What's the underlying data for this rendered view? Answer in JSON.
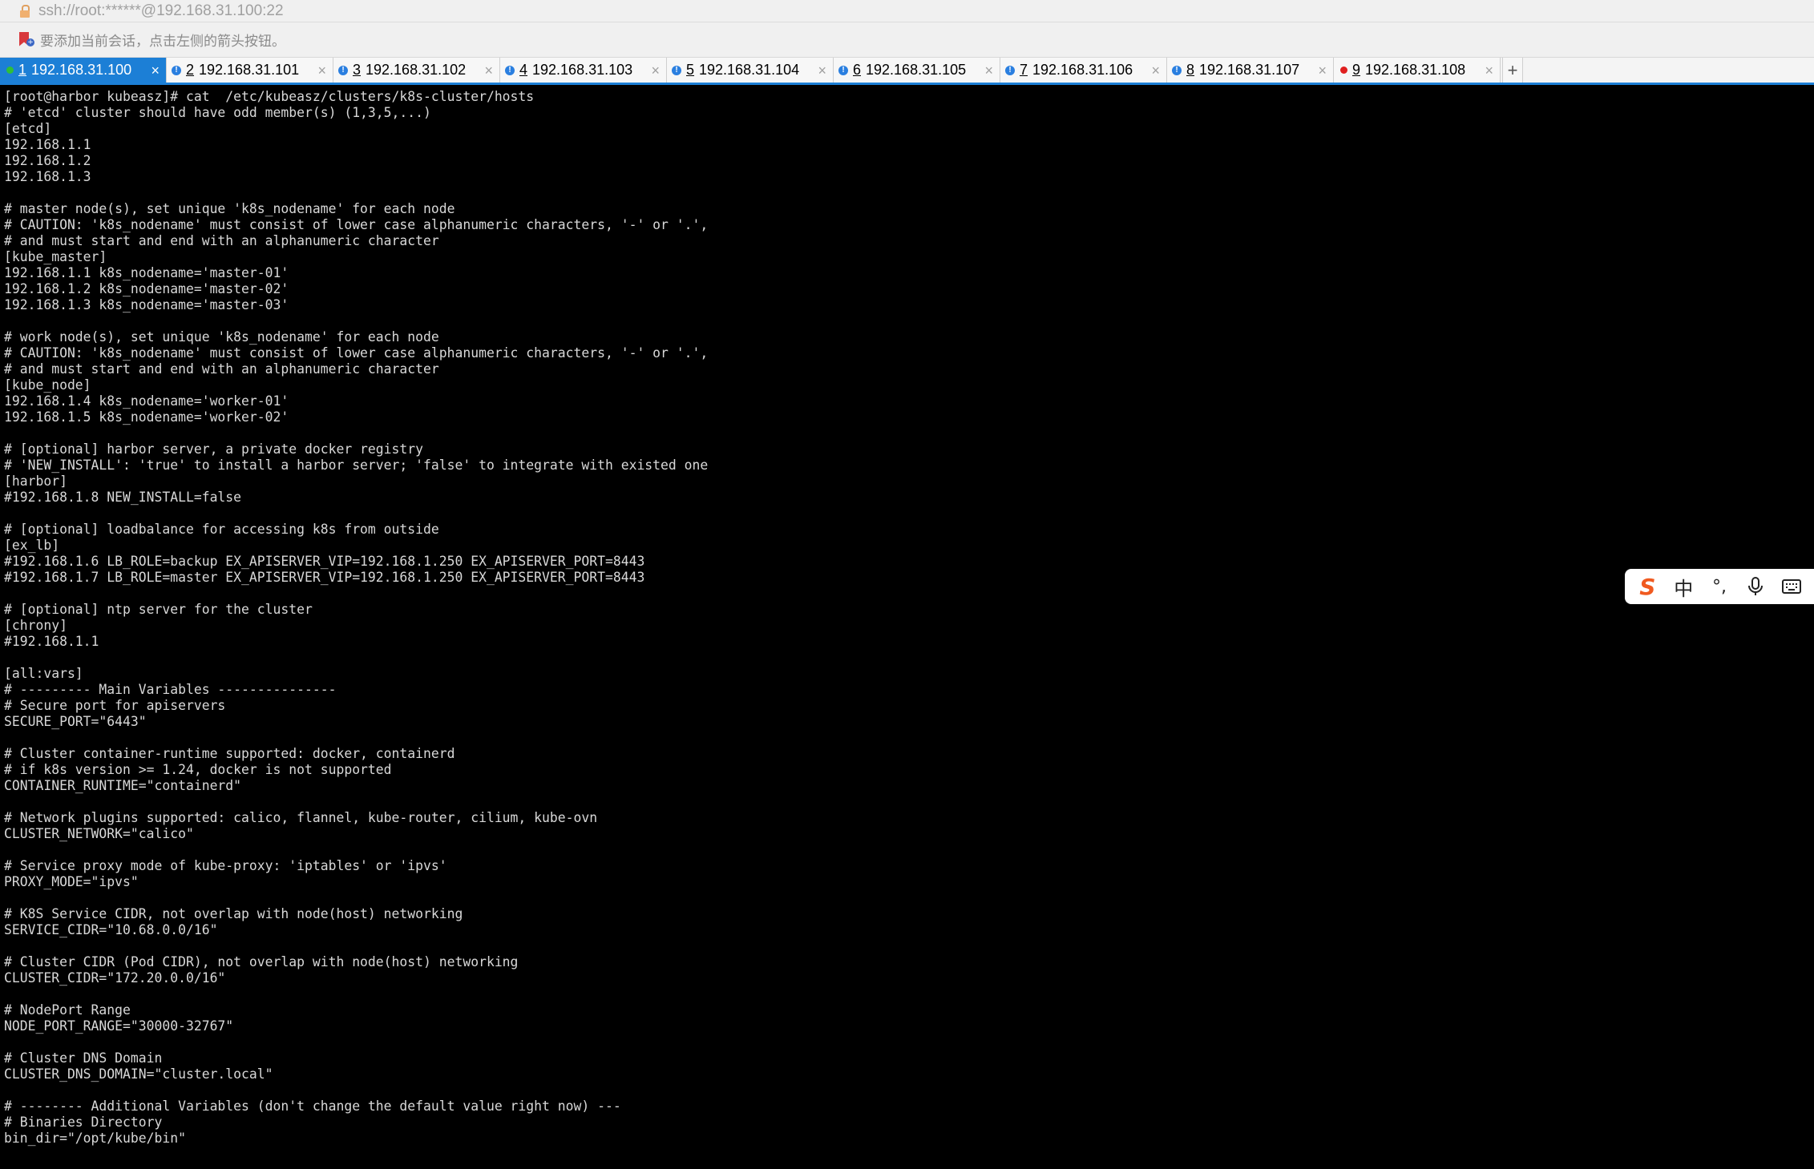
{
  "address_bar": {
    "url": "ssh://root:******@192.168.31.100:22"
  },
  "hint_bar": {
    "text": "要添加当前会话，点击左侧的箭头按钮。"
  },
  "tabs": [
    {
      "num": "1",
      "label": "192.168.31.100",
      "status": "ok",
      "active": true
    },
    {
      "num": "2",
      "label": "192.168.31.101",
      "status": "warn",
      "active": false
    },
    {
      "num": "3",
      "label": "192.168.31.102",
      "status": "warn",
      "active": false
    },
    {
      "num": "4",
      "label": "192.168.31.103",
      "status": "warn",
      "active": false
    },
    {
      "num": "5",
      "label": "192.168.31.104",
      "status": "warn",
      "active": false
    },
    {
      "num": "6",
      "label": "192.168.31.105",
      "status": "warn",
      "active": false
    },
    {
      "num": "7",
      "label": "192.168.31.106",
      "status": "warn",
      "active": false
    },
    {
      "num": "8",
      "label": "192.168.31.107",
      "status": "warn",
      "active": false
    },
    {
      "num": "9",
      "label": "192.168.31.108",
      "status": "err",
      "active": false
    }
  ],
  "tab_close_glyph": "×",
  "tab_add_glyph": "+",
  "colors": {
    "active_tab": "#1c7fd6",
    "terminal_bg": "#000000",
    "terminal_fg": "#d8d8d8",
    "status_ok": "#2fbf3a",
    "status_warn": "#2a7fe0",
    "status_err": "#e02020"
  },
  "terminal": {
    "lines": [
      "[root@harbor kubeasz]# cat  /etc/kubeasz/clusters/k8s-cluster/hosts",
      "# 'etcd' cluster should have odd member(s) (1,3,5,...)",
      "[etcd]",
      "192.168.1.1",
      "192.168.1.2",
      "192.168.1.3",
      "",
      "# master node(s), set unique 'k8s_nodename' for each node",
      "# CAUTION: 'k8s_nodename' must consist of lower case alphanumeric characters, '-' or '.',",
      "# and must start and end with an alphanumeric character",
      "[kube_master]",
      "192.168.1.1 k8s_nodename='master-01'",
      "192.168.1.2 k8s_nodename='master-02'",
      "192.168.1.3 k8s_nodename='master-03'",
      "",
      "# work node(s), set unique 'k8s_nodename' for each node",
      "# CAUTION: 'k8s_nodename' must consist of lower case alphanumeric characters, '-' or '.',",
      "# and must start and end with an alphanumeric character",
      "[kube_node]",
      "192.168.1.4 k8s_nodename='worker-01'",
      "192.168.1.5 k8s_nodename='worker-02'",
      "",
      "# [optional] harbor server, a private docker registry",
      "# 'NEW_INSTALL': 'true' to install a harbor server; 'false' to integrate with existed one",
      "[harbor]",
      "#192.168.1.8 NEW_INSTALL=false",
      "",
      "# [optional] loadbalance for accessing k8s from outside",
      "[ex_lb]",
      "#192.168.1.6 LB_ROLE=backup EX_APISERVER_VIP=192.168.1.250 EX_APISERVER_PORT=8443",
      "#192.168.1.7 LB_ROLE=master EX_APISERVER_VIP=192.168.1.250 EX_APISERVER_PORT=8443",
      "",
      "# [optional] ntp server for the cluster",
      "[chrony]",
      "#192.168.1.1",
      "",
      "[all:vars]",
      "# --------- Main Variables ---------------",
      "# Secure port for apiservers",
      "SECURE_PORT=\"6443\"",
      "",
      "# Cluster container-runtime supported: docker, containerd",
      "# if k8s version >= 1.24, docker is not supported",
      "CONTAINER_RUNTIME=\"containerd\"",
      "",
      "# Network plugins supported: calico, flannel, kube-router, cilium, kube-ovn",
      "CLUSTER_NETWORK=\"calico\"",
      "",
      "# Service proxy mode of kube-proxy: 'iptables' or 'ipvs'",
      "PROXY_MODE=\"ipvs\"",
      "",
      "# K8S Service CIDR, not overlap with node(host) networking",
      "SERVICE_CIDR=\"10.68.0.0/16\"",
      "",
      "# Cluster CIDR (Pod CIDR), not overlap with node(host) networking",
      "CLUSTER_CIDR=\"172.20.0.0/16\"",
      "",
      "# NodePort Range",
      "NODE_PORT_RANGE=\"30000-32767\"",
      "",
      "# Cluster DNS Domain",
      "CLUSTER_DNS_DOMAIN=\"cluster.local\"",
      "",
      "# -------- Additional Variables (don't change the default value right now) ---",
      "# Binaries Directory",
      "bin_dir=\"/opt/kube/bin\""
    ]
  },
  "ime_toolbar": {
    "logo": "S",
    "lang": "中",
    "punct": "°,",
    "icons": [
      "sogou-logo-icon",
      "language-icon",
      "punctuation-icon",
      "microphone-icon",
      "keyboard-icon"
    ]
  }
}
